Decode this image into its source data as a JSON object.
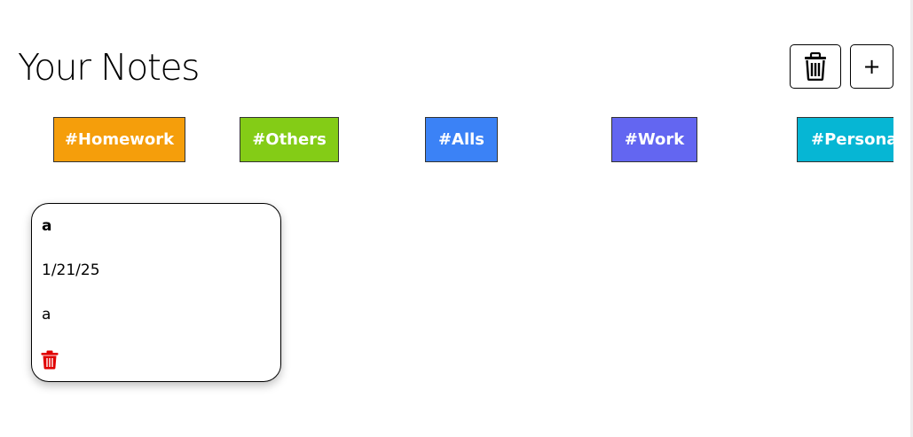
{
  "header": {
    "title": "Your Notes",
    "delete_all_icon": "trash-icon",
    "add_label": "+"
  },
  "tags": [
    {
      "label": "#Homework",
      "color": "#f59e0b"
    },
    {
      "label": "#Others",
      "color": "#84cc16"
    },
    {
      "label": "#Alls",
      "color": "#3b82f6"
    },
    {
      "label": "#Work",
      "color": "#6366f1"
    },
    {
      "label": "#Personal",
      "color": "#06b6d4"
    }
  ],
  "notes": [
    {
      "title": "a",
      "date": "1/21/25",
      "body": "a",
      "delete_icon": "trash-icon",
      "delete_icon_color": "#e00000"
    }
  ]
}
